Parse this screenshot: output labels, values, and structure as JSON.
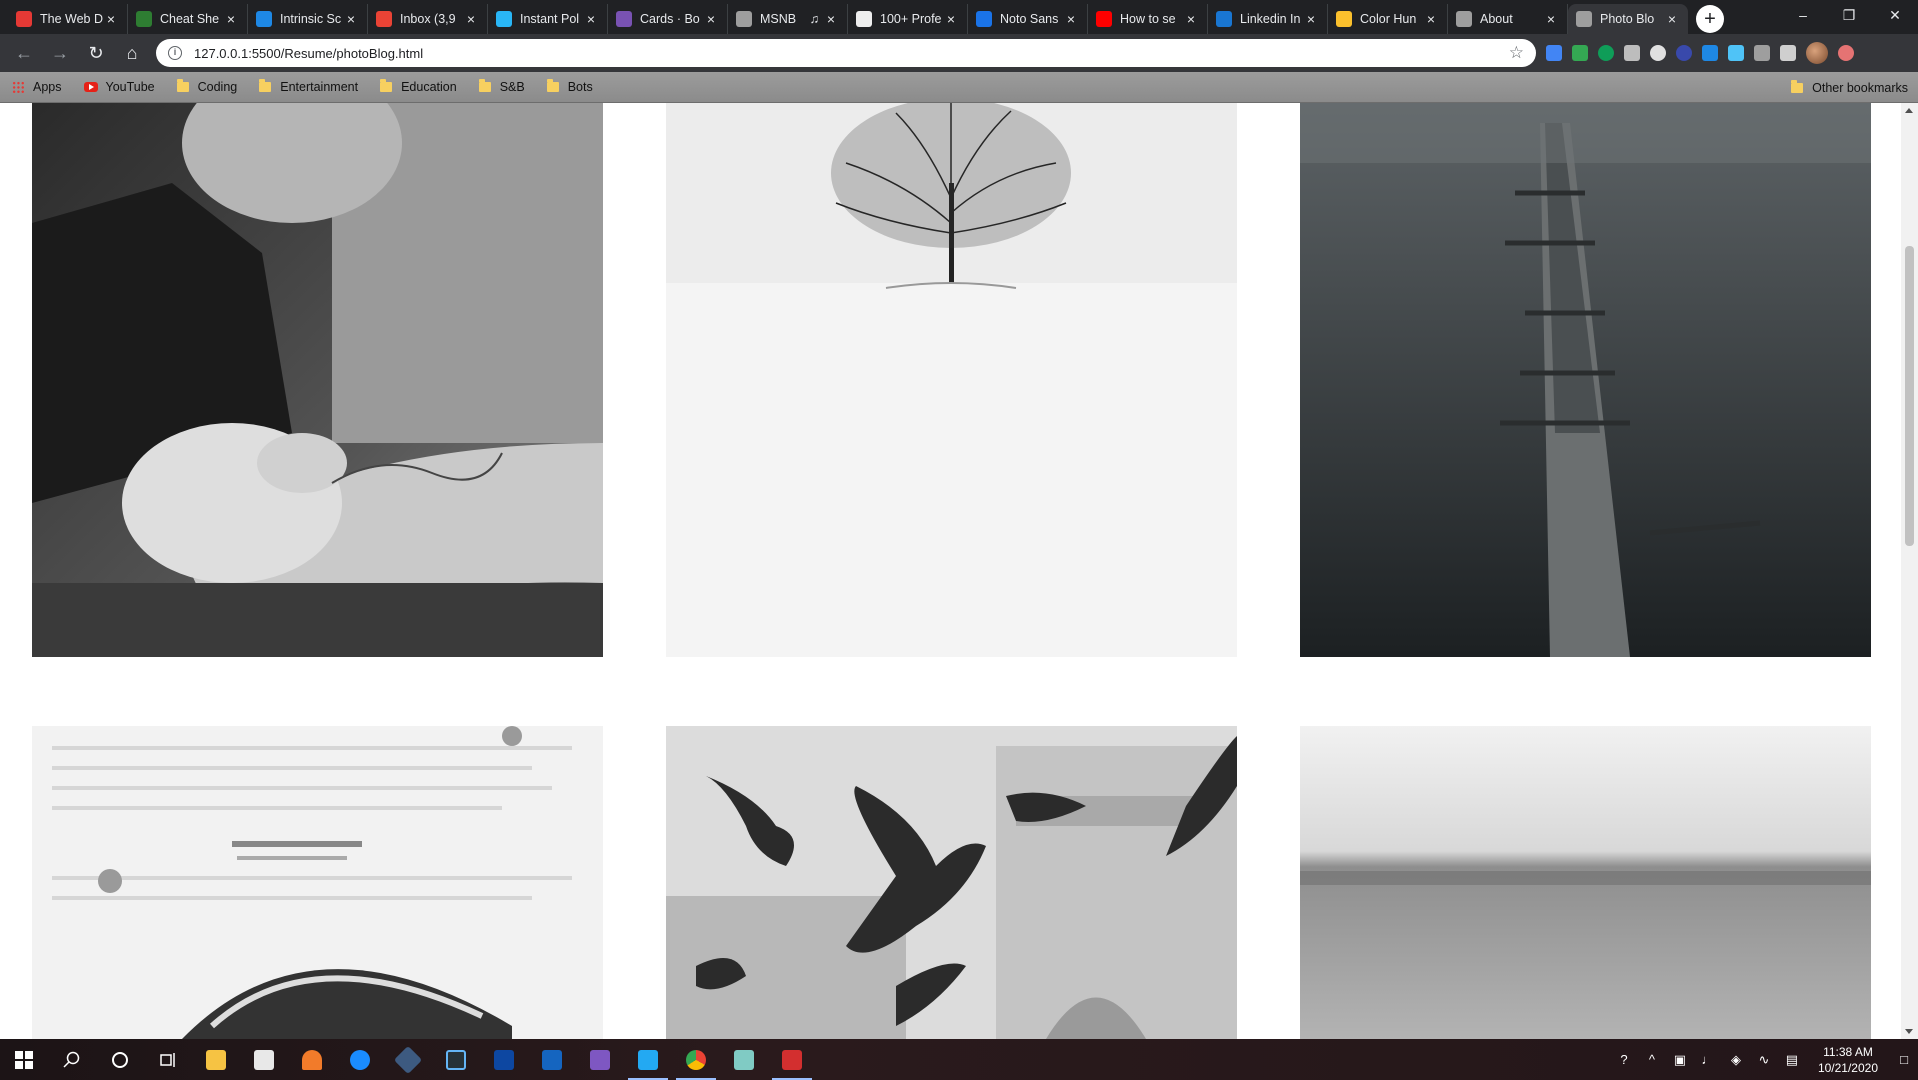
{
  "browser": {
    "tabs": [
      {
        "title": "The Web D",
        "favicon": "swirl-icon",
        "color": "#e53935"
      },
      {
        "title": "Cheat She",
        "favicon": "leaf-icon",
        "color": "#2e7d32"
      },
      {
        "title": "Intrinsic Sc",
        "favicon": "bird-icon",
        "color": "#1e88e5"
      },
      {
        "title": "Inbox (3,9",
        "favicon": "gmail-icon",
        "color": "#ea4335"
      },
      {
        "title": "Instant Pol",
        "favicon": "s-icon",
        "color": "#29b6f6"
      },
      {
        "title": "Cards · Bo",
        "favicon": "bootstrap-icon",
        "color": "#7952b3"
      },
      {
        "title": "MSNB",
        "favicon": "globe-icon",
        "color": "#9e9e9e",
        "audio": true
      },
      {
        "title": "100+ Profe",
        "favicon": "suitcase-icon",
        "color": "#eeeeee"
      },
      {
        "title": "Noto Sans",
        "favicon": "fonts-icon",
        "color": "#1a73e8"
      },
      {
        "title": "How to se",
        "favicon": "youtube-icon",
        "color": "#ff0000"
      },
      {
        "title": "Linkedin In",
        "favicon": "flag-icon",
        "color": "#1976d2"
      },
      {
        "title": "Color Hun",
        "favicon": "cup-icon",
        "color": "#fbc02d"
      },
      {
        "title": "About",
        "favicon": "globe-icon",
        "color": "#9e9e9e"
      },
      {
        "title": "Photo Blo",
        "favicon": "globe-icon",
        "color": "#9e9e9e",
        "active": true
      }
    ],
    "close_glyph": "×",
    "new_tab_glyph": "+",
    "url": "127.0.0.1:5500/Resume/photoBlog.html",
    "info_glyph": "i",
    "bookmarks": [
      {
        "label": "Apps",
        "icon": "apps-grid-icon"
      },
      {
        "label": "YouTube",
        "icon": "youtube-icon"
      },
      {
        "label": "Coding",
        "icon": "folder-icon"
      },
      {
        "label": "Entertainment",
        "icon": "folder-icon"
      },
      {
        "label": "Education",
        "icon": "folder-icon"
      },
      {
        "label": "S&B",
        "icon": "folder-icon"
      },
      {
        "label": "Bots",
        "icon": "folder-icon"
      }
    ],
    "other_bookmarks": "Other bookmarks"
  },
  "photos": [
    {
      "subject": "tattoo-artist",
      "tone": "dark"
    },
    {
      "subject": "lone-tree-snow",
      "tone": "light"
    },
    {
      "subject": "broken-pier",
      "tone": "dark"
    },
    {
      "subject": "poster-wall",
      "tone": "light"
    },
    {
      "subject": "pigeons-building",
      "tone": "light"
    },
    {
      "subject": "foggy-sea",
      "tone": "light"
    }
  ],
  "taskbar": {
    "time": "11:38 AM",
    "date": "10/21/2020"
  }
}
